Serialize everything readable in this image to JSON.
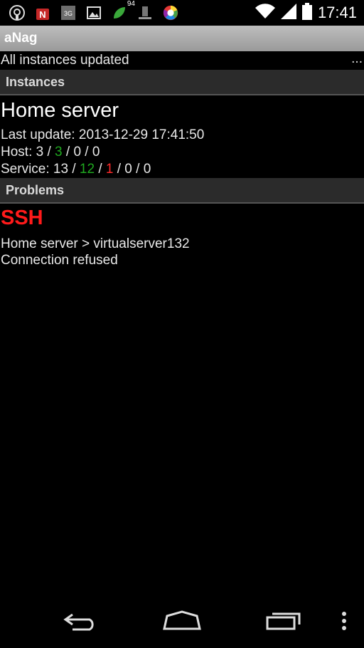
{
  "statusbar": {
    "clock": "17:41",
    "notif_badge": "94",
    "icons": [
      "podcast-icon",
      "android-n-icon",
      "3g-icon",
      "picture-icon",
      "leaf-icon",
      "device-icon",
      "color-wheel-icon"
    ],
    "right_icons": [
      "wifi-icon",
      "signal-icon",
      "battery-icon"
    ]
  },
  "app": {
    "title": "aNag",
    "status_text": "All instances updated",
    "status_more": "..."
  },
  "instances": {
    "header": "Instances",
    "items": [
      {
        "name": "Home server",
        "last_update_label": "Last update: ",
        "last_update_value": "2013-12-29 17:41:50",
        "host_label": "Host: ",
        "host_total": "3",
        "host_ok": "3",
        "host_rest": " / 0 / 0",
        "service_label": "Service: ",
        "service_total": "13",
        "service_ok": "12",
        "service_crit": "1",
        "service_rest": " / 0 / 0"
      }
    ]
  },
  "problems": {
    "header": "Problems",
    "items": [
      {
        "service": "SSH",
        "path": "Home server > virtualserver132",
        "message": "Connection refused"
      }
    ]
  },
  "colors": {
    "ok": "#1fa81f",
    "critical": "#ff1a1a",
    "background": "#000000"
  },
  "navbar": {
    "buttons": [
      "back-icon",
      "home-icon",
      "recents-icon",
      "overflow-menu-icon"
    ]
  }
}
